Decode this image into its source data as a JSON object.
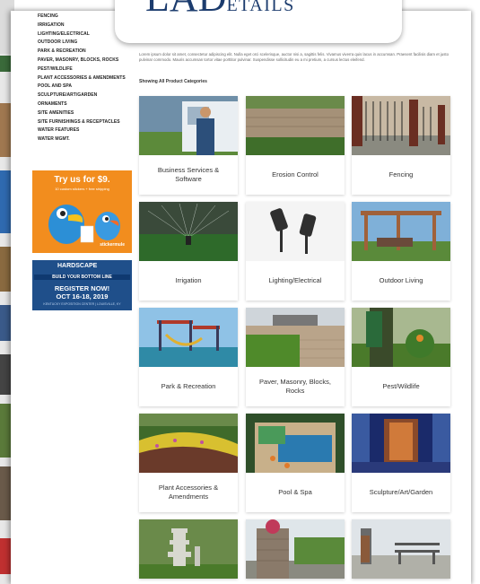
{
  "sidebar": {
    "categories": [
      "FENCING",
      "IRRIGATION",
      "LIGHTING/ELECTRICAL",
      "OUTDOOR LIVING",
      "PARK & RECREATION",
      "PAVER, MASONRY, BLOCKS, ROCKS",
      "PEST/WILDLIFE",
      "PLANT ACCESSORIES & AMENDMENTS",
      "POOL AND SPA",
      "SCULPTURE/ART/GARDEN",
      "ORNAMENTS",
      "SITE AMENITIES",
      "SITE FURNISHINGS & RECEPTACLES",
      "WATER FEATURES",
      "WATER MGMT."
    ]
  },
  "logo": {
    "main": "LAD",
    "sub": "ETAILS"
  },
  "intro_text": "Lorem ipsum dolor sit amet, consectetur adipiscing elit. Nulla eget orci scelerisque, auctor nisi a, sagittis felis. Vivamus viverra quis lacus in accumsan. Praesent facilisis diam et justo pulvinar commodo. Mauris accumsan tortor vitae porttitor pulvinar. Suspendisse sollicitudin eu a mi pretium, a cursus lectus eleifend.",
  "showing_label": "Showing All Product Categories",
  "ads": {
    "stickermule": {
      "title": "Try us for $9.",
      "subtitle": "10 custom stickers + free shipping",
      "brand": "stickermule"
    },
    "hardscape": {
      "line1": "HARDSCAPE",
      "line2": "BUILD YOUR BOTTOM LINE",
      "line3": "REGISTER NOW!",
      "line4": "OCT 16-18, 2019",
      "line5": "KENTUCKY EXPOSITION CENTER | LOUISVILLE, KY"
    }
  },
  "grid": {
    "cards": [
      {
        "label": "Business Services & Software",
        "photo": "person-van"
      },
      {
        "label": "Erosion Control",
        "photo": "stone-wall"
      },
      {
        "label": "Fencing",
        "photo": "iron-fence"
      },
      {
        "label": "Irrigation",
        "photo": "sprinkler"
      },
      {
        "label": "Lighting/Electrical",
        "photo": "spotlights"
      },
      {
        "label": "Outdoor Living",
        "photo": "pergola"
      },
      {
        "label": "Park & Recreation",
        "photo": "playground"
      },
      {
        "label": "Paver, Masonry, Blocks, Rocks",
        "photo": "pavers"
      },
      {
        "label": "Pest/Wildlife",
        "photo": "spraying"
      },
      {
        "label": "Plant Accessories & Amendments",
        "photo": "flower-bed"
      },
      {
        "label": "Pool & Spa",
        "photo": "pool"
      },
      {
        "label": "Sculpture/Art/Garden",
        "photo": "sculpture"
      },
      {
        "label": "",
        "photo": "pagoda"
      },
      {
        "label": "",
        "photo": "stone-planter"
      },
      {
        "label": "",
        "photo": "bench"
      }
    ]
  },
  "colors": {
    "logo": "#1c3c6e",
    "ad_orange": "#f28d1e",
    "ad_blue": "#1f4f8a"
  }
}
